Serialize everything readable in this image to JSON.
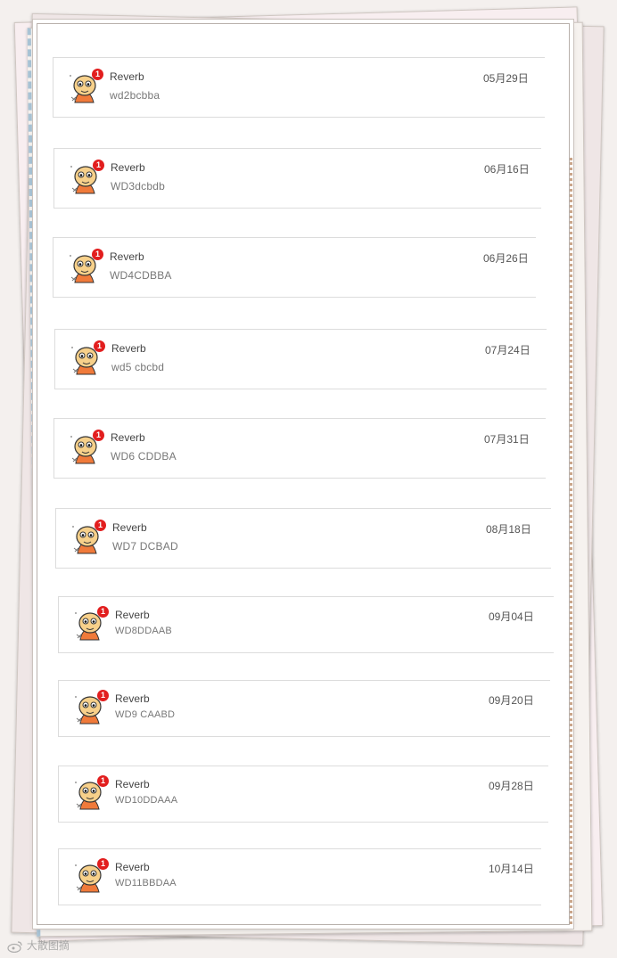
{
  "messages": [
    {
      "sender": "Reverb",
      "preview": "wd2bcbba",
      "date": "05月29日",
      "badge": "1"
    },
    {
      "sender": "Reverb",
      "preview": "WD3dcbdb",
      "date": "06月16日",
      "badge": "1"
    },
    {
      "sender": "Reverb",
      "preview": "WD4CDBBA",
      "date": "06月26日",
      "badge": "1"
    },
    {
      "sender": "Reverb",
      "preview": "wd5 cbcbd",
      "date": "07月24日",
      "badge": "1"
    },
    {
      "sender": "Reverb",
      "preview": "WD6 CDDBA",
      "date": "07月31日",
      "badge": "1"
    },
    {
      "sender": "Reverb",
      "preview": "WD7 DCBAD",
      "date": "08月18日",
      "badge": "1"
    },
    {
      "sender": "Reverb",
      "preview": "WD8DDAAB",
      "date": "09月04日",
      "badge": "1"
    },
    {
      "sender": "Reverb",
      "preview": "WD9 CAABD",
      "date": "09月20日",
      "badge": "1"
    },
    {
      "sender": "Reverb",
      "preview": "WD10DDAAA",
      "date": "09月28日",
      "badge": "1"
    },
    {
      "sender": "Reverb",
      "preview": "WD11BBDAA",
      "date": "10月14日",
      "badge": "1"
    }
  ],
  "watermark": {
    "text": "大散图摘",
    "icon": "weibo-icon"
  },
  "colors": {
    "badge": "#e21e1e",
    "avatar_skin": "#f7d08a",
    "avatar_shirt": "#f07a3a"
  }
}
